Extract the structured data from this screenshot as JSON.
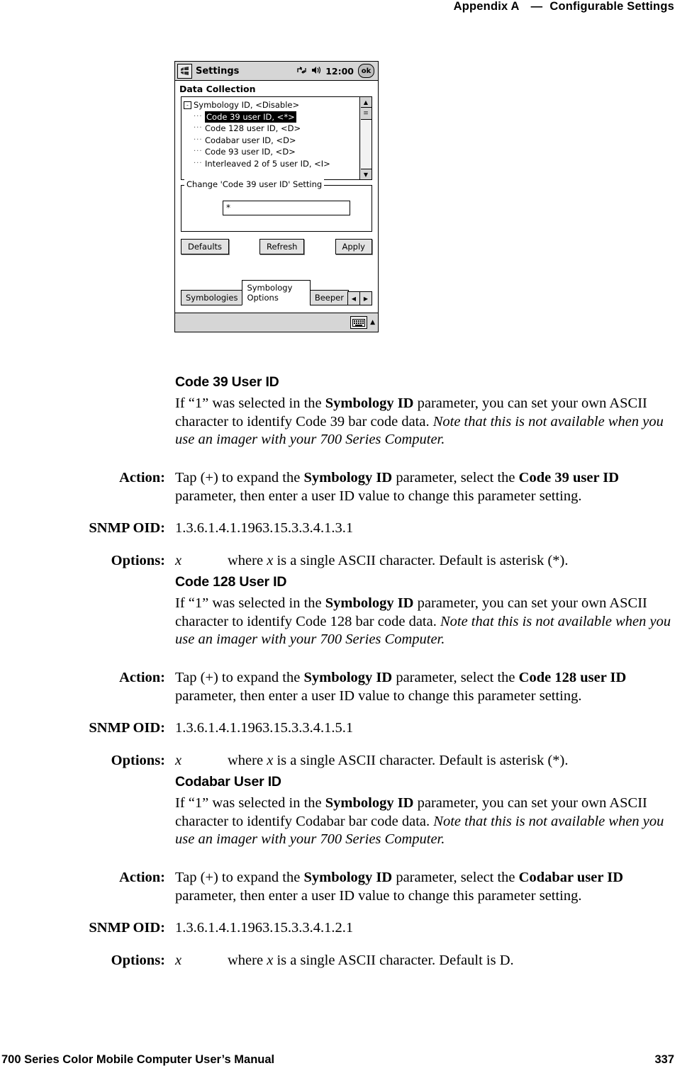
{
  "running_head": {
    "appendix": "Appendix A",
    "dash": "—",
    "title": "Configurable Settings"
  },
  "screenshot": {
    "titlebar": {
      "logo_icon": "windows-logo-icon",
      "title": "Settings",
      "network_icon": "network-icon",
      "speaker_icon": "speaker-icon",
      "clock": "12:00",
      "ok_label": "ok"
    },
    "panel_title": "Data Collection",
    "tree": {
      "root": "Symbology ID, <Disable>",
      "items": [
        "Code 39 user ID, <*>",
        "Code 128 user ID, <D>",
        "Codabar user ID, <D>",
        "Code 93 user ID, <D>",
        "Interleaved 2 of 5 user ID, <I>"
      ],
      "selected_index": 0,
      "expander": "-"
    },
    "group": {
      "label": "Change 'Code 39 user ID' Setting",
      "input_value": "*"
    },
    "buttons": {
      "defaults": "Defaults",
      "refresh": "Refresh",
      "apply": "Apply"
    },
    "tabs": [
      {
        "label": "Symbologies",
        "active": false
      },
      {
        "label": "Symbology Options",
        "active": true
      },
      {
        "label": "Beeper",
        "active": false
      }
    ],
    "tab_arrows": {
      "left": "◀",
      "right": "▶"
    },
    "taskbar": {
      "keyboard_icon": "keyboard-icon",
      "arrow": "▲"
    }
  },
  "sections": [
    {
      "heading": "Code 39 User ID",
      "body_parts": [
        {
          "t": "If “1” was selected in the ",
          "style": "n"
        },
        {
          "t": "Symbology ID",
          "style": "b"
        },
        {
          "t": " parameter, you can set your own ASCII character to identify Code 39 bar code data. ",
          "style": "n"
        },
        {
          "t": "Note that this is not available when you use an imager with your 700 Series Computer.",
          "style": "i"
        }
      ],
      "action_label": "Action:",
      "action_parts": [
        {
          "t": "Tap (+) to expand the ",
          "style": "n"
        },
        {
          "t": "Symbology ID",
          "style": "b"
        },
        {
          "t": " parameter, select the ",
          "style": "n"
        },
        {
          "t": "Code 39 user ID",
          "style": "b"
        },
        {
          "t": " parameter, then enter a user ID value to change this parameter setting.",
          "style": "n"
        }
      ],
      "snmp_label": "SNMP OID:",
      "snmp_value": "1.3.6.1.4.1.1963.15.3.3.4.1.3.1",
      "options_label": "Options:",
      "options_var": "x",
      "options_parts": [
        {
          "t": "where ",
          "style": "n"
        },
        {
          "t": "x",
          "style": "i"
        },
        {
          "t": " is a single ASCII character. Default is asterisk (*).",
          "style": "n"
        }
      ]
    },
    {
      "heading": "Code 128 User ID",
      "body_parts": [
        {
          "t": "If “1” was selected in the ",
          "style": "n"
        },
        {
          "t": "Symbology ID",
          "style": "b"
        },
        {
          "t": " parameter, you can set your own ASCII character to identify Code 128 bar code data. ",
          "style": "n"
        },
        {
          "t": "Note that this is not available when you use an imager with your 700 Series Computer.",
          "style": "i"
        }
      ],
      "action_label": "Action:",
      "action_parts": [
        {
          "t": "Tap (+) to expand the ",
          "style": "n"
        },
        {
          "t": "Symbology ID",
          "style": "b"
        },
        {
          "t": " parameter, select the ",
          "style": "n"
        },
        {
          "t": "Code 128 user ID",
          "style": "b"
        },
        {
          "t": " parameter, then enter a user ID value to change this parameter setting.",
          "style": "n"
        }
      ],
      "snmp_label": "SNMP OID:",
      "snmp_value": "1.3.6.1.4.1.1963.15.3.3.4.1.5.1",
      "options_label": "Options:",
      "options_var": "x",
      "options_parts": [
        {
          "t": "where ",
          "style": "n"
        },
        {
          "t": "x",
          "style": "i"
        },
        {
          "t": " is a single ASCII character. Default is asterisk (*).",
          "style": "n"
        }
      ]
    },
    {
      "heading": "Codabar User ID",
      "body_parts": [
        {
          "t": "If “1” was selected in the ",
          "style": "n"
        },
        {
          "t": "Symbology ID",
          "style": "b"
        },
        {
          "t": " parameter, you can set your own ASCII character to identify Codabar bar code data. ",
          "style": "n"
        },
        {
          "t": "Note that this is not available when you use an imager with your 700 Series Computer.",
          "style": "i"
        }
      ],
      "action_label": "Action:",
      "action_parts": [
        {
          "t": "Tap (+) to expand the ",
          "style": "n"
        },
        {
          "t": "Symbology ID",
          "style": "b"
        },
        {
          "t": " parameter, select the ",
          "style": "n"
        },
        {
          "t": "Codabar user ID",
          "style": "b"
        },
        {
          "t": " parameter, then enter a user ID value to change this parameter setting.",
          "style": "n"
        }
      ],
      "snmp_label": "SNMP OID:",
      "snmp_value": "1.3.6.1.4.1.1963.15.3.3.4.1.2.1",
      "options_label": "Options:",
      "options_var": "x",
      "options_parts": [
        {
          "t": "where ",
          "style": "n"
        },
        {
          "t": "x",
          "style": "i"
        },
        {
          "t": " is a single ASCII character. Default is D.",
          "style": "n"
        }
      ]
    }
  ],
  "footer": {
    "manual": "700 Series Color Mobile Computer User’s Manual",
    "page": "337"
  }
}
